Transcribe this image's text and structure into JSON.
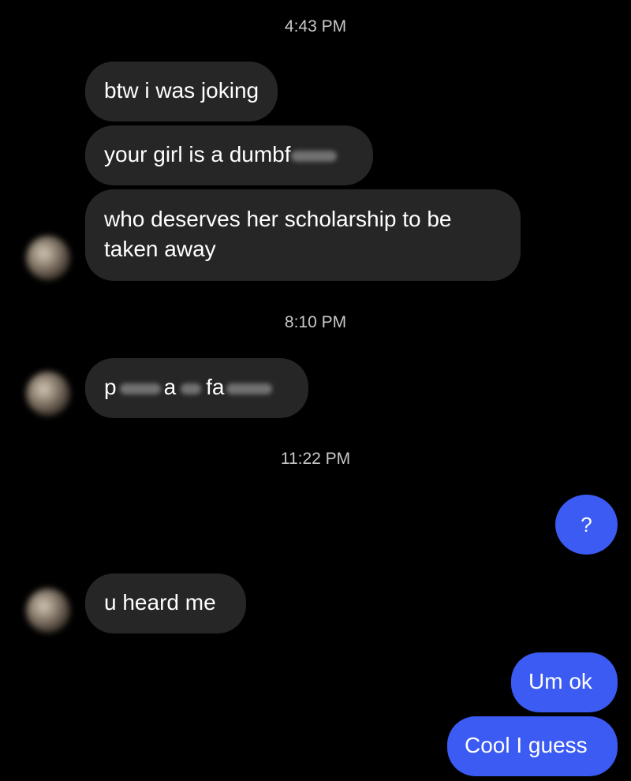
{
  "colors": {
    "background": "#000000",
    "incoming_bubble": "#262626",
    "outgoing_bubble": "#3b5bf2",
    "timestamp_text": "#c9c9c9"
  },
  "timestamps": [
    "4:43 PM",
    "8:10 PM",
    "11:22 PM"
  ],
  "messages": {
    "m1": "btw i was joking",
    "m2": "your girl is a dumbf",
    "m3_line1": "who deserves her scholarship to be",
    "m3_line2": "taken away",
    "m4_a": "p",
    "m4_b": "a",
    "m4_c": "fa",
    "m5": "?",
    "m6": "u heard me",
    "m7": "Um ok",
    "m8": "Cool I guess"
  }
}
